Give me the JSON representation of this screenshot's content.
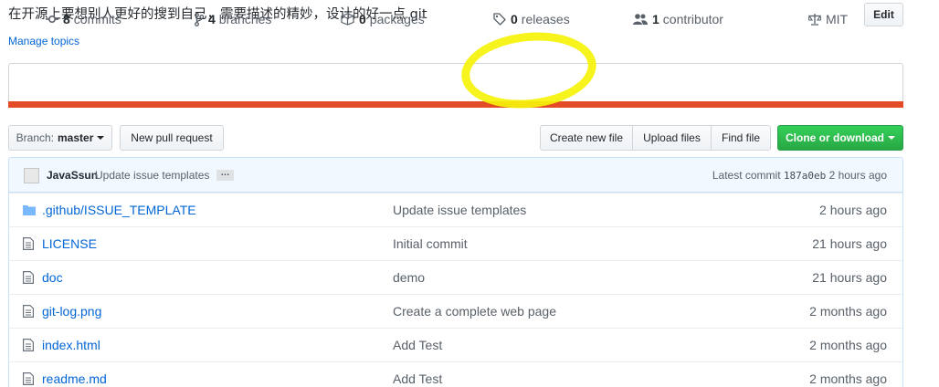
{
  "repo": {
    "description": "在开源上要想别人更好的搜到自己，需要描述的精妙，设计的好一点 git",
    "manage_topics": "Manage topics",
    "edit_label": "Edit"
  },
  "numbers_summary": {
    "commits": {
      "count": "8",
      "label": "commits",
      "icon": "commit-icon"
    },
    "branches": {
      "count": "4",
      "label": "branches",
      "icon": "branch-icon"
    },
    "packages": {
      "count": "0",
      "label": "packages",
      "icon": "package-icon"
    },
    "releases": {
      "count": "0",
      "label": "releases",
      "icon": "tag-icon"
    },
    "contributors": {
      "count": "1",
      "label": "contributor",
      "icon": "people-icon"
    },
    "license": {
      "label": "MIT",
      "icon": "law-icon"
    },
    "language_bar_color": "#e34c26",
    "highlight_color": "#f5f20a"
  },
  "toolbar": {
    "branch_prefix": "Branch:",
    "branch_name": "master",
    "new_pull_request": "New pull request",
    "create_new_file": "Create new file",
    "upload_files": "Upload files",
    "find_file": "Find file",
    "clone_or_download": "Clone or download"
  },
  "latest_commit": {
    "author": "JavaSsun",
    "message": "Update issue templates",
    "ellipsis": "…",
    "prefix": "Latest commit",
    "sha": "187a0eb",
    "age": "2 hours ago"
  },
  "files": [
    {
      "name": ".github/ISSUE_TEMPLATE",
      "type": "folder",
      "message": "Update issue templates",
      "age": "2 hours ago"
    },
    {
      "name": "LICENSE",
      "type": "file",
      "message": "Initial commit",
      "age": "21 hours ago"
    },
    {
      "name": "doc",
      "type": "file",
      "message": "demo",
      "age": "21 hours ago"
    },
    {
      "name": "git-log.png",
      "type": "file",
      "message": "Create a complete web page",
      "age": "2 months ago"
    },
    {
      "name": "index.html",
      "type": "file",
      "message": "Add Test",
      "age": "2 months ago"
    },
    {
      "name": "readme.md",
      "type": "file",
      "message": "Add Test",
      "age": "2 months ago"
    }
  ]
}
